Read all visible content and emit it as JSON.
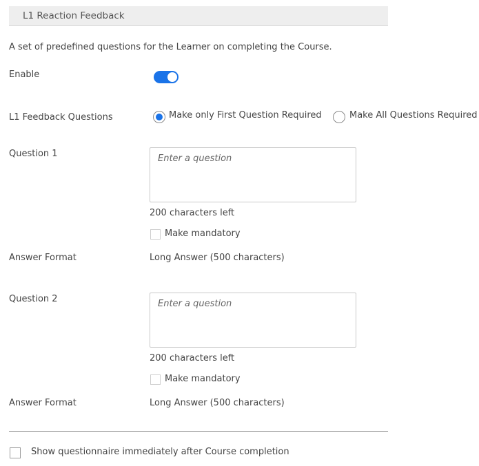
{
  "section": {
    "title": "L1 Reaction Feedback",
    "description": "A set of predefined questions for the Learner on completing the Course."
  },
  "enable": {
    "label": "Enable",
    "on": true,
    "color": "#1a73e8"
  },
  "feedback_questions": {
    "label": "L1 Feedback Questions",
    "options": [
      {
        "label": "Make only First Question Required",
        "selected": true
      },
      {
        "label": "Make All Questions Required",
        "selected": false
      }
    ]
  },
  "questions": [
    {
      "label": "Question 1",
      "value": "",
      "placeholder": "Enter a question",
      "chars_left": "200 characters left",
      "mandatory_label": "Make mandatory",
      "mandatory": false,
      "answer_format_label": "Answer Format",
      "answer_format_value": "Long Answer (500 characters)"
    },
    {
      "label": "Question 2",
      "value": "",
      "placeholder": "Enter a question",
      "chars_left": "200 characters left",
      "mandatory_label": "Make mandatory",
      "mandatory": false,
      "answer_format_label": "Answer Format",
      "answer_format_value": "Long Answer (500 characters)"
    }
  ],
  "show_after_completion": {
    "label": "Show questionnaire immediately after Course completion",
    "checked": false
  }
}
